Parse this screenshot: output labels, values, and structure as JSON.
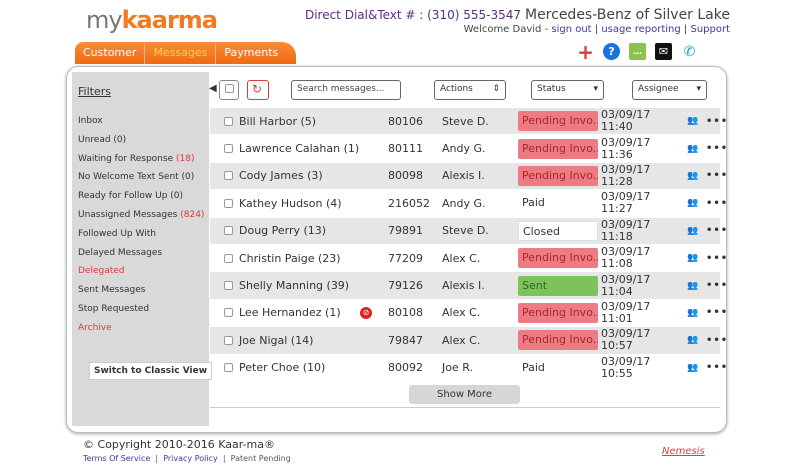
{
  "header": {
    "logo": "mykaarma",
    "logo_my": "my",
    "logo_brand": "kaarma",
    "direct_dial": "Direct Dial&Text # : (310) 555-3547",
    "dealer": "Mercedes-Benz of Silver Lake",
    "welcome": "Welcome David - ",
    "sign_out": "sign out",
    "usage": "usage reporting",
    "support": "Support",
    "sep": "|"
  },
  "tabs": [
    {
      "label": "Customer"
    },
    {
      "label": "Messages",
      "active": true
    },
    {
      "label": "Payments"
    }
  ],
  "icons": [
    "plus-icon",
    "help-icon",
    "chat-icon",
    "mail-icon",
    "phone-icon"
  ],
  "sidebar": {
    "title": "Filters",
    "items": [
      {
        "label": "Inbox",
        "count": ""
      },
      {
        "label": "Unread (0)",
        "count": ""
      },
      {
        "label": "Waiting for Response",
        "count": "(18)"
      },
      {
        "label": "No Welcome Text Sent (0)",
        "count": ""
      },
      {
        "label": "Ready for Follow Up (0)",
        "count": ""
      },
      {
        "label": "Unassigned Messages",
        "count": "(824)"
      },
      {
        "label": "Followed Up With",
        "count": ""
      },
      {
        "label": "Delayed Messages",
        "count": ""
      },
      {
        "label": "Delegated",
        "count": "",
        "red": true
      },
      {
        "label": "Sent Messages",
        "count": ""
      },
      {
        "label": "Stop Requested",
        "count": ""
      },
      {
        "label": "Archive",
        "count": "",
        "red": true
      }
    ],
    "classic_view": "Switch to Classic View"
  },
  "toolbar": {
    "search_placeholder": "Search messages...",
    "actions": "Actions",
    "status": "Status",
    "assignee": "Assignee"
  },
  "rows": [
    {
      "name": "Bill Harbor (5)",
      "num": "80106",
      "advisor": "Steve D.",
      "status": "Pending Invo...",
      "type": "pend",
      "date": "03/09/17",
      "time": "11:40"
    },
    {
      "name": "Lawrence Calahan (1)",
      "num": "80111",
      "advisor": "Andy G.",
      "status": "Pending Invo...",
      "type": "pend",
      "date": "03/09/17",
      "time": "11:36"
    },
    {
      "name": "Cody James (3)",
      "num": "80098",
      "advisor": "Alexis I.",
      "status": "Pending Invo...",
      "type": "pend",
      "date": "03/09/17",
      "time": "11:28"
    },
    {
      "name": "Kathey Hudson (4)",
      "num": "216052",
      "advisor": "Andy G.",
      "status": "Paid",
      "type": "plain",
      "date": "03/09/17",
      "time": "11:27"
    },
    {
      "name": "Doug Perry (13)",
      "num": "79891",
      "advisor": "Steve D.",
      "status": "Closed",
      "type": "closed",
      "date": "03/09/17",
      "time": "11:18"
    },
    {
      "name": "Christin Paige (23)",
      "num": "77209",
      "advisor": "Alex C.",
      "status": "Pending Invo...",
      "type": "pend",
      "date": "03/09/17",
      "time": "11:08"
    },
    {
      "name": "Shelly Manning (39)",
      "num": "79126",
      "advisor": "Alexis I.",
      "status": "Sent",
      "type": "sent",
      "date": "03/09/17",
      "time": "11:04"
    },
    {
      "name": "Lee Hernandez (1)",
      "num": "80108",
      "advisor": "Alex C.",
      "status": "Pending Invo...",
      "type": "pend",
      "date": "03/09/17",
      "time": "11:01",
      "flag": true
    },
    {
      "name": "Joe Nigal (14)",
      "num": "79847",
      "advisor": "Alex C.",
      "status": "Pending Invo...",
      "type": "pend",
      "date": "03/09/17",
      "time": "10:57"
    },
    {
      "name": "Peter Choe (10)",
      "num": "80092",
      "advisor": "Joe R.",
      "status": "Paid",
      "type": "plain",
      "date": "03/09/17",
      "time": "10:55"
    }
  ],
  "show_more": "Show More",
  "footer": {
    "copyright": "© Copyright 2010-2016 Kaar-ma®",
    "terms": "Terms Of Service",
    "privacy": "Privacy Policy",
    "patent": "Patent Pending",
    "nemesis": "Nemesis"
  }
}
